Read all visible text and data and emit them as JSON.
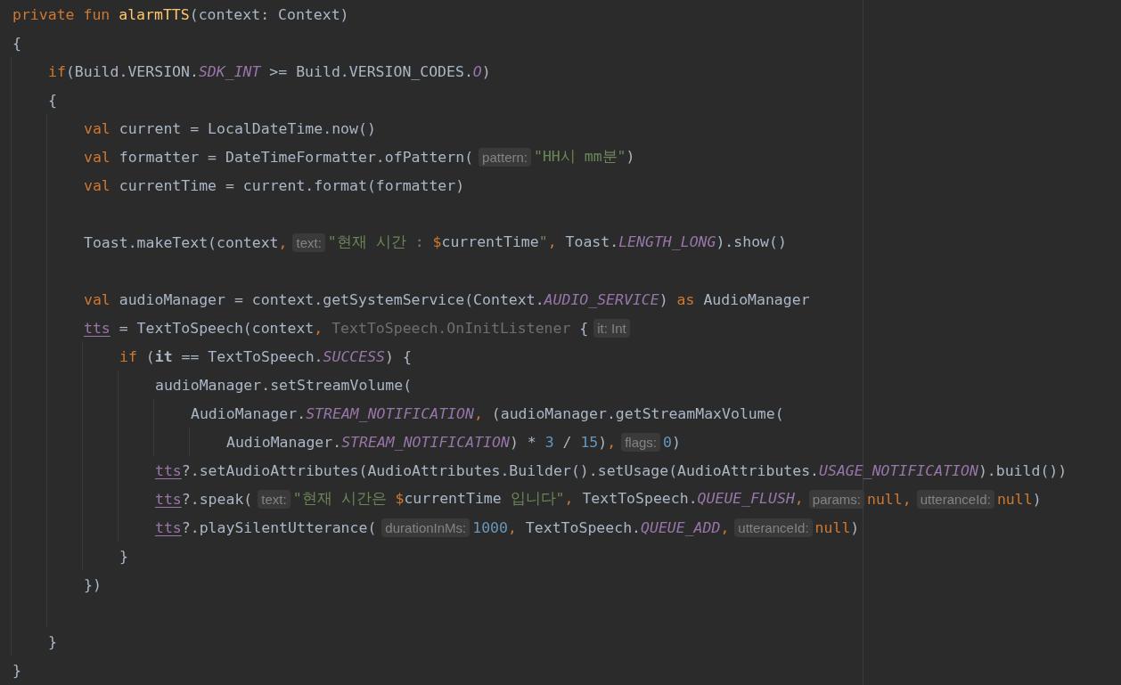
{
  "editor": {
    "lines": [
      {
        "kind": "code",
        "parts": [
          {
            "kind": "code",
            "tokens": [
              {
                "kind": "kw",
                "text": "private fun "
              },
              {
                "kind": "fn",
                "text": "alarmTTS"
              },
              {
                "kind": "plain",
                "text": "(context: Context)"
              }
            ]
          }
        ]
      },
      {
        "kind": "code",
        "parts": [
          {
            "kind": "code",
            "tokens": [
              {
                "kind": "plain",
                "text": "{"
              }
            ]
          }
        ],
        "children": [
          {
            "kind": "code",
            "parts": [
              {
                "kind": "code",
                "tokens": [
                  {
                    "kind": "kw",
                    "text": "if"
                  },
                  {
                    "kind": "plain",
                    "text": "(Build.VERSION."
                  },
                  {
                    "kind": "const",
                    "text": "SDK_INT"
                  },
                  {
                    "kind": "plain",
                    "text": " >= Build.VERSION_CODES."
                  },
                  {
                    "kind": "const",
                    "text": "O"
                  },
                  {
                    "kind": "plain",
                    "text": ")"
                  }
                ]
              }
            ]
          },
          {
            "kind": "code",
            "parts": [
              {
                "kind": "code",
                "tokens": [
                  {
                    "kind": "plain",
                    "text": "{"
                  }
                ]
              }
            ],
            "children": [
              {
                "kind": "code",
                "parts": [
                  {
                    "kind": "code",
                    "tokens": [
                      {
                        "kind": "kw",
                        "text": "val "
                      },
                      {
                        "kind": "plain",
                        "text": "current = LocalDateTime.now()"
                      }
                    ]
                  }
                ]
              },
              {
                "kind": "code",
                "parts": [
                  {
                    "kind": "code",
                    "tokens": [
                      {
                        "kind": "kw",
                        "text": "val "
                      },
                      {
                        "kind": "plain",
                        "text": "formatter = DateTimeFormatter.ofPattern("
                      }
                    ]
                  },
                  {
                    "kind": "hint",
                    "text": "pattern:"
                  },
                  {
                    "kind": "code",
                    "tokens": [
                      {
                        "kind": "str",
                        "text": "\"HH시 mm분\""
                      },
                      {
                        "kind": "plain",
                        "text": ")"
                      }
                    ]
                  }
                ]
              },
              {
                "kind": "code",
                "parts": [
                  {
                    "kind": "code",
                    "tokens": [
                      {
                        "kind": "kw",
                        "text": "val "
                      },
                      {
                        "kind": "plain",
                        "text": "currentTime = current.format(formatter)"
                      }
                    ]
                  }
                ]
              },
              {
                "kind": "blank"
              },
              {
                "kind": "code",
                "parts": [
                  {
                    "kind": "code",
                    "tokens": [
                      {
                        "kind": "plain",
                        "text": "Toast.makeText(context"
                      },
                      {
                        "kind": "kw",
                        "text": ","
                      }
                    ]
                  },
                  {
                    "kind": "hint",
                    "text": "text:"
                  },
                  {
                    "kind": "code",
                    "tokens": [
                      {
                        "kind": "str",
                        "text": "\"현재 시간 : "
                      },
                      {
                        "kind": "kw",
                        "text": "$"
                      },
                      {
                        "kind": "plain",
                        "text": "currentTime"
                      },
                      {
                        "kind": "str",
                        "text": "\""
                      },
                      {
                        "kind": "kw",
                        "text": ","
                      },
                      {
                        "kind": "plain",
                        "text": " Toast."
                      },
                      {
                        "kind": "const",
                        "text": "LENGTH_LONG"
                      },
                      {
                        "kind": "plain",
                        "text": ").show()"
                      }
                    ]
                  }
                ]
              },
              {
                "kind": "blank"
              },
              {
                "kind": "code",
                "parts": [
                  {
                    "kind": "code",
                    "tokens": [
                      {
                        "kind": "kw",
                        "text": "val "
                      },
                      {
                        "kind": "plain",
                        "text": "audioManager = context.getSystemService(Context."
                      },
                      {
                        "kind": "const",
                        "text": "AUDIO_SERVICE"
                      },
                      {
                        "kind": "plain",
                        "text": ") "
                      },
                      {
                        "kind": "kw",
                        "text": "as"
                      },
                      {
                        "kind": "plain",
                        "text": " AudioManager"
                      }
                    ]
                  }
                ]
              },
              {
                "kind": "code",
                "parts": [
                  {
                    "kind": "code",
                    "tokens": [
                      {
                        "kind": "prop",
                        "text": "tts"
                      },
                      {
                        "kind": "plain",
                        "text": " = TextToSpeech(context"
                      },
                      {
                        "kind": "kw",
                        "text": ","
                      },
                      {
                        "kind": "faded",
                        "text": " TextToSpeech.OnInitListener "
                      },
                      {
                        "kind": "plain",
                        "text": "{"
                      }
                    ]
                  },
                  {
                    "kind": "hint",
                    "text": "it: Int"
                  }
                ],
                "children": [
                  {
                    "kind": "code",
                    "parts": [
                      {
                        "kind": "code",
                        "tokens": [
                          {
                            "kind": "kw",
                            "text": "if "
                          },
                          {
                            "kind": "plain",
                            "text": "("
                          },
                          {
                            "kind": "bold",
                            "text": "it"
                          },
                          {
                            "kind": "plain",
                            "text": " == TextToSpeech."
                          },
                          {
                            "kind": "const",
                            "text": "SUCCESS"
                          },
                          {
                            "kind": "plain",
                            "text": ") {"
                          }
                        ]
                      }
                    ],
                    "children": [
                      {
                        "kind": "code",
                        "parts": [
                          {
                            "kind": "code",
                            "tokens": [
                              {
                                "kind": "plain",
                                "text": "audioManager.setStreamVolume("
                              }
                            ]
                          }
                        ],
                        "children": [
                          {
                            "kind": "code",
                            "parts": [
                              {
                                "kind": "code",
                                "tokens": [
                                  {
                                    "kind": "plain",
                                    "text": "AudioManager."
                                  },
                                  {
                                    "kind": "const",
                                    "text": "STREAM_NOTIFICATION"
                                  },
                                  {
                                    "kind": "kw",
                                    "text": ","
                                  },
                                  {
                                    "kind": "plain",
                                    "text": " (audioManager.getStreamMaxVolume("
                                  }
                                ]
                              }
                            ],
                            "children": [
                              {
                                "kind": "code",
                                "parts": [
                                  {
                                    "kind": "code",
                                    "tokens": [
                                      {
                                        "kind": "plain",
                                        "text": "AudioManager."
                                      },
                                      {
                                        "kind": "const",
                                        "text": "STREAM_NOTIFICATION"
                                      },
                                      {
                                        "kind": "plain",
                                        "text": ") * "
                                      },
                                      {
                                        "kind": "num",
                                        "text": "3"
                                      },
                                      {
                                        "kind": "plain",
                                        "text": " / "
                                      },
                                      {
                                        "kind": "num",
                                        "text": "15"
                                      },
                                      {
                                        "kind": "plain",
                                        "text": ")"
                                      },
                                      {
                                        "kind": "kw",
                                        "text": ","
                                      }
                                    ]
                                  },
                                  {
                                    "kind": "hint",
                                    "text": "flags:"
                                  },
                                  {
                                    "kind": "code",
                                    "tokens": [
                                      {
                                        "kind": "num",
                                        "text": "0"
                                      },
                                      {
                                        "kind": "plain",
                                        "text": ")"
                                      }
                                    ]
                                  }
                                ]
                              }
                            ]
                          }
                        ]
                      },
                      {
                        "kind": "code",
                        "parts": [
                          {
                            "kind": "code",
                            "tokens": [
                              {
                                "kind": "prop",
                                "text": "tts"
                              },
                              {
                                "kind": "plain",
                                "text": "?.setAudioAttributes(AudioAttributes.Builder().setUsage(AudioAttributes."
                              },
                              {
                                "kind": "const",
                                "text": "USAGE_NOTIFICATION"
                              },
                              {
                                "kind": "plain",
                                "text": ").build())"
                              }
                            ]
                          }
                        ]
                      },
                      {
                        "kind": "code",
                        "parts": [
                          {
                            "kind": "code",
                            "tokens": [
                              {
                                "kind": "prop",
                                "text": "tts"
                              },
                              {
                                "kind": "plain",
                                "text": "?.speak("
                              }
                            ]
                          },
                          {
                            "kind": "hint",
                            "text": "text:"
                          },
                          {
                            "kind": "code",
                            "tokens": [
                              {
                                "kind": "str",
                                "text": "\"현재 시간은 "
                              },
                              {
                                "kind": "kw",
                                "text": "$"
                              },
                              {
                                "kind": "plain",
                                "text": "currentTime"
                              },
                              {
                                "kind": "str",
                                "text": " 입니다\""
                              },
                              {
                                "kind": "kw",
                                "text": ","
                              },
                              {
                                "kind": "plain",
                                "text": " TextToSpeech."
                              },
                              {
                                "kind": "const",
                                "text": "QUEUE_FLUSH"
                              },
                              {
                                "kind": "kw",
                                "text": ","
                              }
                            ]
                          },
                          {
                            "kind": "hint",
                            "text": "params:"
                          },
                          {
                            "kind": "code",
                            "tokens": [
                              {
                                "kind": "kw",
                                "text": "null,"
                              }
                            ]
                          },
                          {
                            "kind": "hint",
                            "text": "utteranceId:"
                          },
                          {
                            "kind": "code",
                            "tokens": [
                              {
                                "kind": "kw",
                                "text": "null"
                              },
                              {
                                "kind": "plain",
                                "text": ")"
                              }
                            ]
                          }
                        ]
                      },
                      {
                        "kind": "code",
                        "parts": [
                          {
                            "kind": "code",
                            "tokens": [
                              {
                                "kind": "prop",
                                "text": "tts"
                              },
                              {
                                "kind": "plain",
                                "text": "?.playSilentUtterance("
                              }
                            ]
                          },
                          {
                            "kind": "hint",
                            "text": "durationInMs:"
                          },
                          {
                            "kind": "code",
                            "tokens": [
                              {
                                "kind": "num",
                                "text": "1000"
                              },
                              {
                                "kind": "kw",
                                "text": ","
                              },
                              {
                                "kind": "plain",
                                "text": " TextToSpeech."
                              },
                              {
                                "kind": "const",
                                "text": "QUEUE_ADD"
                              },
                              {
                                "kind": "kw",
                                "text": ","
                              }
                            ]
                          },
                          {
                            "kind": "hint",
                            "text": "utteranceId:"
                          },
                          {
                            "kind": "code",
                            "tokens": [
                              {
                                "kind": "kw",
                                "text": "null"
                              },
                              {
                                "kind": "plain",
                                "text": ")"
                              }
                            ]
                          }
                        ]
                      }
                    ]
                  },
                  {
                    "kind": "code",
                    "parts": [
                      {
                        "kind": "code",
                        "tokens": [
                          {
                            "kind": "plain",
                            "text": "}"
                          }
                        ]
                      }
                    ]
                  }
                ]
              },
              {
                "kind": "code",
                "parts": [
                  {
                    "kind": "code",
                    "tokens": [
                      {
                        "kind": "plain",
                        "text": "})"
                      }
                    ]
                  }
                ]
              },
              {
                "kind": "blank"
              }
            ]
          },
          {
            "kind": "code",
            "parts": [
              {
                "kind": "code",
                "tokens": [
                  {
                    "kind": "plain",
                    "text": "}"
                  }
                ]
              }
            ]
          }
        ]
      },
      {
        "kind": "code",
        "parts": [
          {
            "kind": "code",
            "tokens": [
              {
                "kind": "plain",
                "text": "}"
              }
            ]
          }
        ]
      }
    ]
  }
}
